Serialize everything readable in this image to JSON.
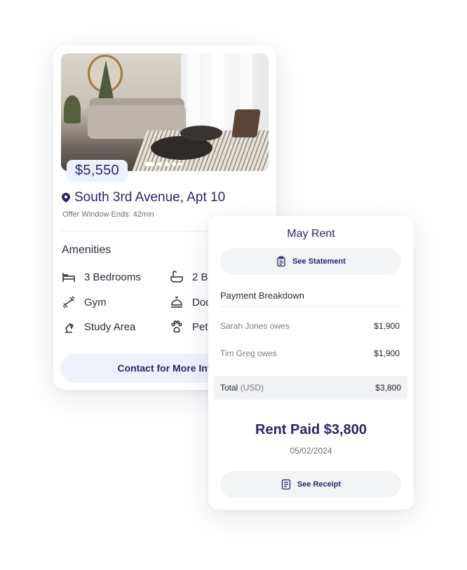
{
  "listing": {
    "price": "$5,550",
    "address": "South 3rd Avenue, Apt 10",
    "offer_window": "Offer Window Ends: 42min",
    "amenities_title": "Amenities",
    "amenities": [
      {
        "label": "3 Bedrooms",
        "icon": "bed-icon"
      },
      {
        "label": "2 B",
        "icon": "bathtub-icon"
      },
      {
        "label": "Gym",
        "icon": "dumbbell-icon"
      },
      {
        "label": "Doc",
        "icon": "concierge-bell-icon"
      },
      {
        "label": "Study Area",
        "icon": "desk-lamp-icon"
      },
      {
        "label": "Pet",
        "icon": "paw-icon"
      }
    ],
    "contact_label": "Contact for More Inf",
    "carousel_count": 5,
    "carousel_active": 1
  },
  "rent": {
    "title": "May Rent",
    "see_statement": "See Statement",
    "breakdown_title": "Payment Breakdown",
    "rows": [
      {
        "name": "Sarah Jones owes",
        "value": "$1,900"
      },
      {
        "name": "Tim Greg owes",
        "value": "$1,900"
      }
    ],
    "total_label": "Total",
    "total_currency": "(USD)",
    "total_value": "$3,800",
    "paid_text": "Rent Paid $3,800",
    "paid_date": "05/02/2024",
    "see_receipt": "See Receipt"
  },
  "colors": {
    "brand_navy": "#2b2467",
    "pill_bg": "#f3f4f6",
    "price_bg": "#ecf2fd"
  }
}
